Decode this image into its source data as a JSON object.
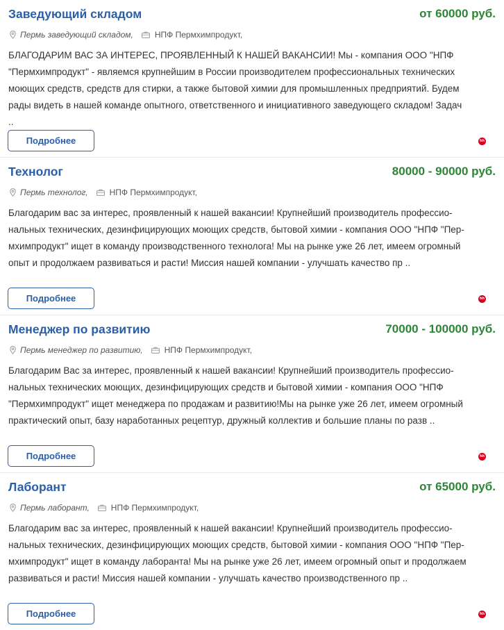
{
  "colors": {
    "title": "#2a5fa8",
    "salary": "#2d8536",
    "button_border": "#2a5fa8",
    "badge": "#d6001c"
  },
  "vacancies": [
    {
      "title": "Заведующий складом",
      "salary": "от 60000 руб.",
      "location": "Пермь заведующий складом,",
      "company": "НПФ Пермхимпродукт,",
      "description_lines": [
        "БЛАГОДАРИМ ВАС ЗА ИНТЕРЕС, ПРОЯВЛЕННЫЙ К НАШЕЙ ВАКАНСИИ! Мы - компания ООО \"НПФ",
        "\"Пермхимпродукт\" - являемся крупнейшим в России производителем профессиональных технических",
        "моющих средств, средств для стирки, а также бытовой химии для промышленных предприятий. Будем",
        "рады видеть в нашей команде опытного, ответственного и инициативного заведующего складом! Задач",
        ".."
      ],
      "button_label": "Подробнее",
      "badge_icon": "hh-logo-icon",
      "badge_text": "hh"
    },
    {
      "title": "Технолог",
      "salary": "80000 - 90000 руб.",
      "location": "Пермь технолог,",
      "company": "НПФ Пермхимпродукт,",
      "description_lines": [
        "Благодарим вас за интерес, проявленный к нашей вакансии! Крупнейший производитель профессио-",
        "нальных технических, дезинфицирующих моющих средств, бытовой химии - компания ООО \"НПФ \"Пер-",
        "мхимпродукт\" ищет в команду производственного технолога! Мы на рынке уже 26 лет, имеем огромный",
        "опыт и продолжаем развиваться и расти! Миссия нашей компании - улучшать качество пр .."
      ],
      "button_label": "Подробнее",
      "badge_icon": "hh-logo-icon",
      "badge_text": "hh"
    },
    {
      "title": "Менеджер по развитию",
      "salary": "70000 - 100000 руб.",
      "location": "Пермь менеджер по развитию,",
      "company": "НПФ Пермхимпродукт,",
      "description_lines": [
        "Благодарим Вас за интерес, проявленный к нашей вакансии! Крупнейший производитель профессио-",
        "нальных технических моющих, дезинфицирующих средств и бытовой химии - компания ООО \"НПФ",
        "\"Пермхимпродукт\" ищет менеджера по продажам и развитию!Мы на рынке уже 26 лет, имеем огромный",
        "практический опыт, базу наработанных рецептур, дружный коллектив и большие планы по разв .."
      ],
      "button_label": "Подробнее",
      "badge_icon": "hh-logo-icon",
      "badge_text": "hh"
    },
    {
      "title": "Лаборант",
      "salary": "от 65000 руб.",
      "location": "Пермь лаборант,",
      "company": "НПФ Пермхимпродукт,",
      "description_lines": [
        "Благодарим вас за интерес, проявленный к нашей вакансии! Крупнейший производитель профессио-",
        "нальных технических, дезинфицирующих моющих средств, бытовой химии - компания ООО \"НПФ \"Пер-",
        "мхимпродукт\" ищет в команду лаборанта! Мы на рынке уже 26 лет, имеем огромный опыт и продолжаем",
        "развиваться и расти! Миссия нашей компании - улучшать качество производственного пр .."
      ],
      "button_label": "Подробнее",
      "badge_icon": "hh-logo-icon",
      "badge_text": "hh"
    }
  ]
}
